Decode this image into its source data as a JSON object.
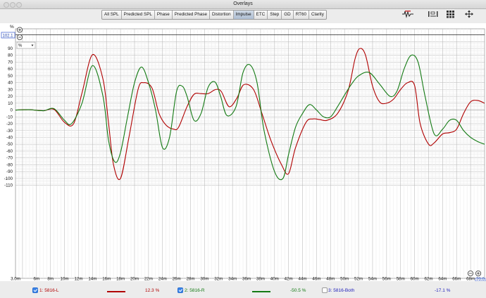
{
  "window": {
    "title": "Overlays"
  },
  "tabs": [
    {
      "label": "All SPL",
      "active": false
    },
    {
      "label": "Predicted SPL",
      "active": false
    },
    {
      "label": "Phase",
      "active": false
    },
    {
      "label": "Predicted Phase",
      "active": false
    },
    {
      "label": "Distortion",
      "active": false
    },
    {
      "label": "Impulse",
      "active": true
    },
    {
      "label": "ETC",
      "active": false
    },
    {
      "label": "Step",
      "active": false
    },
    {
      "label": "GD",
      "active": false
    },
    {
      "label": "RT60",
      "active": false
    },
    {
      "label": "Clarity",
      "active": false
    }
  ],
  "toolbar_icons": [
    "waveform-capture-icon",
    "marker-controls-icon",
    "grid-icon",
    "move-arrows-icon"
  ],
  "plot": {
    "y_unit": "%",
    "y_top_value": "102.1",
    "unit_select": "%",
    "x_end_value": "70.0",
    "zoom_in_symbol": "⊕",
    "zoom_out_symbol": "⊖"
  },
  "chart_data": {
    "type": "line",
    "xlabel": "",
    "ylabel": "%",
    "xlim": [
      3.0,
      70.0
    ],
    "ylim": [
      -110,
      102.1
    ],
    "x_tick_labels": [
      "3.0m",
      "6m",
      "8m",
      "10m",
      "12m",
      "14m",
      "16m",
      "18m",
      "20m",
      "22m",
      "24m",
      "26m",
      "28m",
      "30m",
      "32m",
      "34m",
      "36m",
      "38m",
      "40m",
      "42m",
      "44m",
      "46m",
      "48m",
      "50m",
      "52m",
      "54m",
      "56m",
      "58m",
      "60m",
      "62m",
      "64m",
      "66m",
      "68m"
    ],
    "y_ticks": [
      90,
      80,
      70,
      60,
      50,
      40,
      30,
      20,
      10,
      0,
      -10,
      -20,
      -30,
      -40,
      -50,
      -60,
      -70,
      -80,
      -90,
      -100,
      -110
    ],
    "grid": true,
    "series": [
      {
        "name": "1: 5816-L",
        "color": "#b00000",
        "x": [
          3,
          5,
          7,
          8.5,
          10,
          11.3,
          12.5,
          14,
          15.5,
          16.3,
          17,
          18,
          19.2,
          20.5,
          21.3,
          22.5,
          23.5,
          24.5,
          25.6,
          26.3,
          27.5,
          28.5,
          29.5,
          30.5,
          31.6,
          32.4,
          33.5,
          34.6,
          35.6,
          37,
          38.2,
          39.5,
          41,
          42,
          43,
          44.5,
          45.5,
          46.5,
          47.5,
          49,
          50.5,
          51.5,
          52.2,
          53,
          54,
          55,
          56,
          57,
          58,
          59,
          60,
          60.8,
          62,
          62.8,
          64,
          65,
          66,
          67,
          68,
          69,
          70
        ],
        "y": [
          0,
          0.5,
          -1,
          1,
          -18,
          -20,
          25,
          81,
          45,
          -20,
          -80,
          -100,
          -40,
          30,
          40,
          32,
          -5,
          -22,
          -28,
          -25,
          5,
          23,
          24,
          24,
          30,
          27,
          5,
          17,
          37,
          30,
          -5,
          -45,
          -80,
          -93,
          -55,
          -18,
          -13,
          -14,
          -15,
          -5,
          28,
          75,
          90,
          80,
          35,
          12,
          10,
          16,
          30,
          40,
          36,
          -20,
          -50,
          -48,
          -35,
          -33,
          -28,
          -5,
          12,
          14,
          10
        ]
      },
      {
        "name": "2: 5816-R",
        "color": "#137a13",
        "x": [
          3,
          5,
          7,
          8.5,
          10,
          11,
          12.5,
          14,
          15.5,
          16.3,
          17.2,
          18,
          19,
          20,
          21,
          22,
          23,
          24,
          25,
          26,
          26.8,
          27.5,
          28.5,
          29.5,
          30.5,
          31.5,
          32.3,
          33.2,
          34.5,
          35.5,
          36.5,
          37.5,
          38.5,
          40,
          41.2,
          42,
          43,
          44,
          45,
          46,
          47,
          48,
          49,
          50,
          51,
          52,
          53.5,
          55,
          56.5,
          57.5,
          58.5,
          59.5,
          60.5,
          61.5,
          62.8,
          64,
          65,
          66,
          67,
          68,
          69,
          70
        ],
        "y": [
          0,
          0.5,
          -1,
          2,
          -15,
          -20,
          10,
          65,
          20,
          -45,
          -76,
          -62,
          -10,
          40,
          63,
          40,
          0,
          -55,
          -40,
          27,
          35,
          20,
          -15,
          -5,
          33,
          41,
          20,
          -8,
          5,
          55,
          66,
          40,
          -30,
          -90,
          -100,
          -65,
          -25,
          -5,
          8,
          0,
          -10,
          -10,
          5,
          22,
          38,
          50,
          55,
          38,
          20,
          28,
          60,
          80,
          70,
          20,
          -35,
          -28,
          -15,
          -15,
          -30,
          -40,
          -46,
          -50
        ]
      },
      {
        "name": "3: 5816-Both",
        "color": "#2222bb",
        "x": [],
        "y": []
      }
    ]
  },
  "legend": [
    {
      "checked": true,
      "label": "1: 5816-L",
      "value": "12.3 %",
      "color": "#b00000"
    },
    {
      "checked": true,
      "label": "2: 5816-R",
      "value": "-50.5 %",
      "color": "#137a13"
    },
    {
      "checked": false,
      "label": "3: 5816-Both",
      "value": "-17.1 %",
      "color": "#2222bb"
    }
  ]
}
